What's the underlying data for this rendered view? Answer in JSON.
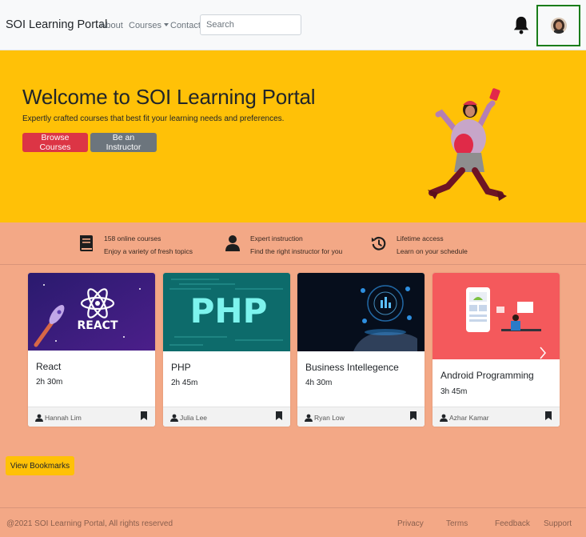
{
  "navbar": {
    "brand": "SOI Learning Portal",
    "links": [
      "About",
      "Courses",
      "Contact"
    ],
    "search_placeholder": "Search",
    "bell_icon": "bell-icon",
    "avatar_icon": "user-avatar"
  },
  "hero": {
    "title": "Welcome to SOI Learning Portal",
    "subtitle": "Expertly crafted courses that best fit your learning needs and preferences.",
    "browse_label": "Browse Courses",
    "instructor_label": "Be an Instructor"
  },
  "features": [
    {
      "icon": "book-icon",
      "line1": "158 online courses",
      "line2": "Enjoy a variety of fresh topics"
    },
    {
      "icon": "user-icon",
      "line1": "Expert instruction",
      "line2": "Find the right instructor for you"
    },
    {
      "icon": "history-icon",
      "line1": "Lifetime access",
      "line2": "Learn on your schedule"
    }
  ],
  "courses": [
    {
      "title": "React",
      "duration": "2h 30m",
      "instructor": "Hannah Lim",
      "image_text": "REACT"
    },
    {
      "title": "PHP",
      "duration": "2h 45m",
      "instructor": "Julia Lee",
      "image_text": "PHP"
    },
    {
      "title": "Business Intellegence",
      "duration": "4h 30m",
      "instructor": "Ryan Low"
    },
    {
      "title": "Android Programming",
      "duration": "3h 45m",
      "instructor": "Azhar Kamar"
    }
  ],
  "view_bookmarks_label": "View Bookmarks",
  "footer": {
    "copyright": "@2021 SOI Learning Portal, All rights reserved",
    "links": [
      "Privacy",
      "Terms",
      "Feedback",
      "Support"
    ]
  },
  "colors": {
    "hero_bg": "#ffc107",
    "page_bg": "#f3a886",
    "browse_button": "#dc3545",
    "instructor_button": "#6c757d",
    "avatar_highlight": "#1a7d1a"
  }
}
